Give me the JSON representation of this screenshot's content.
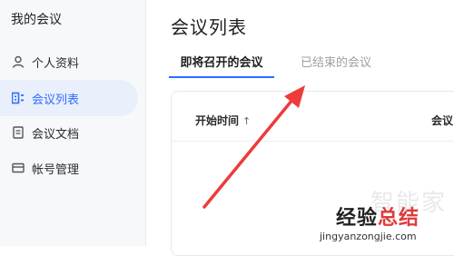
{
  "sidebar": {
    "title": "我的会议",
    "items": [
      {
        "label": "个人资料",
        "icon": "user-icon",
        "active": false
      },
      {
        "label": "会议列表",
        "icon": "meeting-list-icon",
        "active": true
      },
      {
        "label": "会议文档",
        "icon": "document-icon",
        "active": false
      },
      {
        "label": "帐号管理",
        "icon": "account-icon",
        "active": false
      }
    ]
  },
  "main": {
    "title": "会议列表",
    "tabs": [
      {
        "label": "即将召开的会议",
        "active": true
      },
      {
        "label": "已结束的会议",
        "active": false
      }
    ],
    "table": {
      "columns": [
        {
          "label": "开始时间",
          "sort_icon": "↑"
        },
        {
          "label": "会议"
        }
      ]
    }
  },
  "watermark": {
    "top": "智能家",
    "main_black": "经验",
    "main_red": "总结",
    "url": "jingyanzongjie.com"
  },
  "colors": {
    "accent": "#2f6bff",
    "sidebar_bg": "#f7f8fa",
    "active_bg": "#e9effb",
    "annotation_arrow": "#ee3b3b"
  }
}
